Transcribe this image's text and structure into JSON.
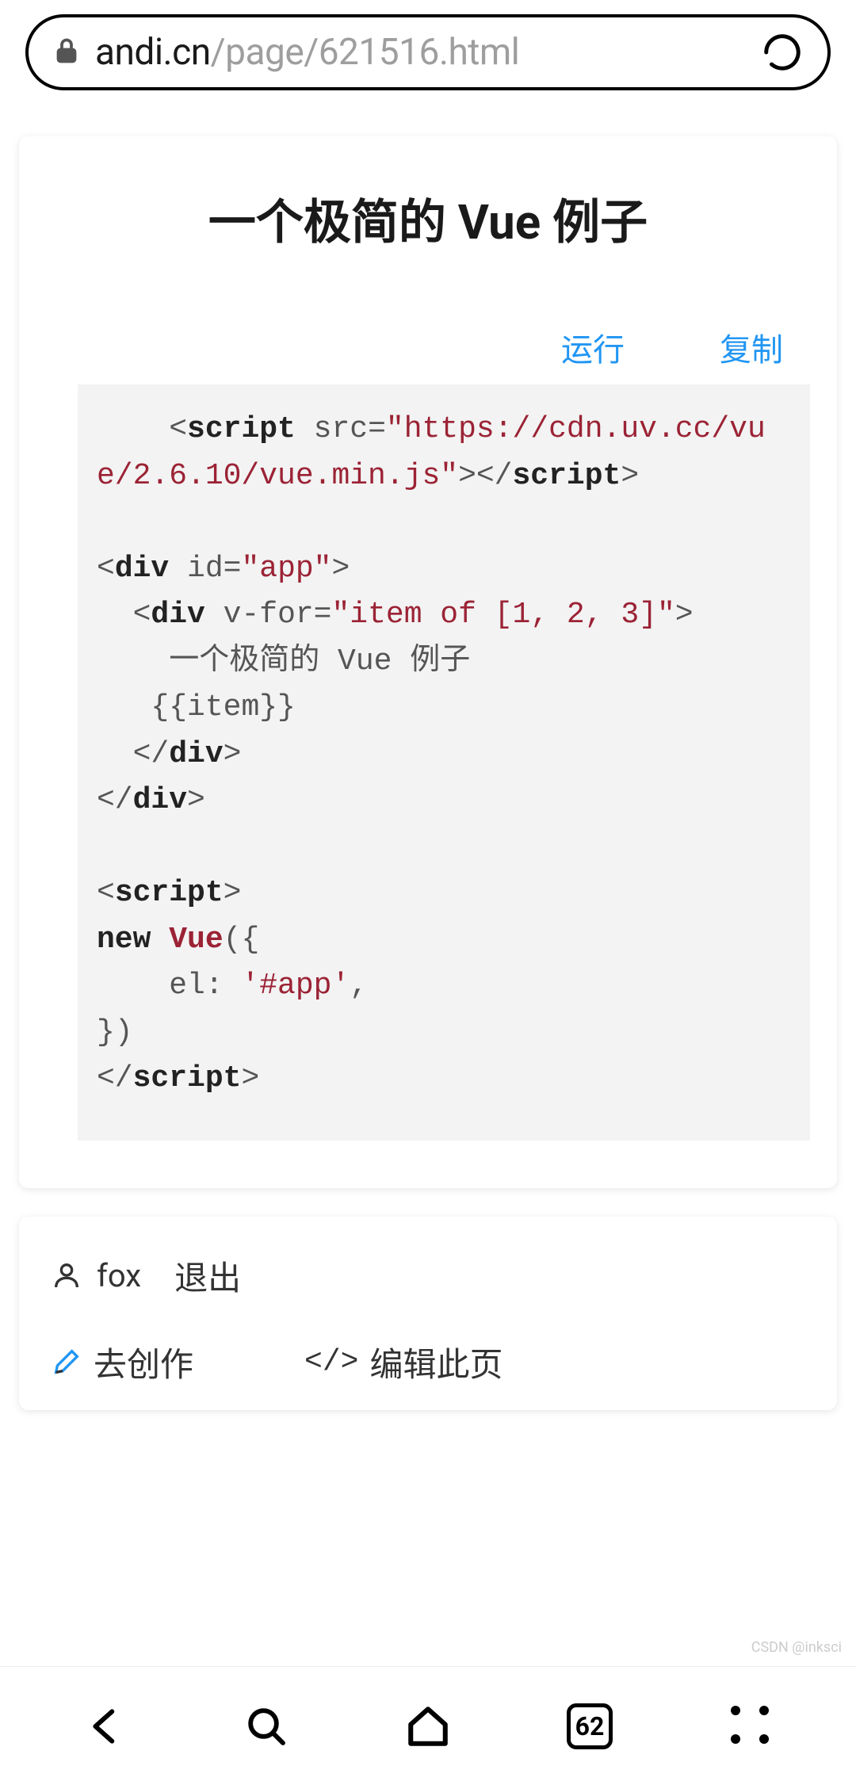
{
  "address_bar": {
    "domain": "andi.cn",
    "path": "/page/621516.html"
  },
  "article": {
    "title": "一个极简的 Vue 例子",
    "actions": {
      "run": "运行",
      "copy": "复制"
    },
    "code": {
      "line1_indent": "    ",
      "script_tag": "script",
      "src_attr": "src=",
      "src_val": "\"https://cdn.uv.cc/vue/2.6.10/vue.min.js\"",
      "div_tag": "div",
      "id_attr": "id=",
      "id_val": "\"app\"",
      "vfor_attr": "v-for=",
      "vfor_val": "\"item of [1, 2, 3]\"",
      "text_line": "    一个极简的 Vue 例子",
      "item_line": "   {{item}}",
      "new_kw": "new",
      "vue_cls": "Vue",
      "el_line": "    el: ",
      "el_val": "'#app'",
      "comma": ","
    }
  },
  "user": {
    "name": "fox",
    "logout": "退出",
    "create": "去创作",
    "edit": "编辑此页",
    "code_icon": "</>"
  },
  "watermark": "CSDN @inksci",
  "nav": {
    "tab_count": "62"
  }
}
